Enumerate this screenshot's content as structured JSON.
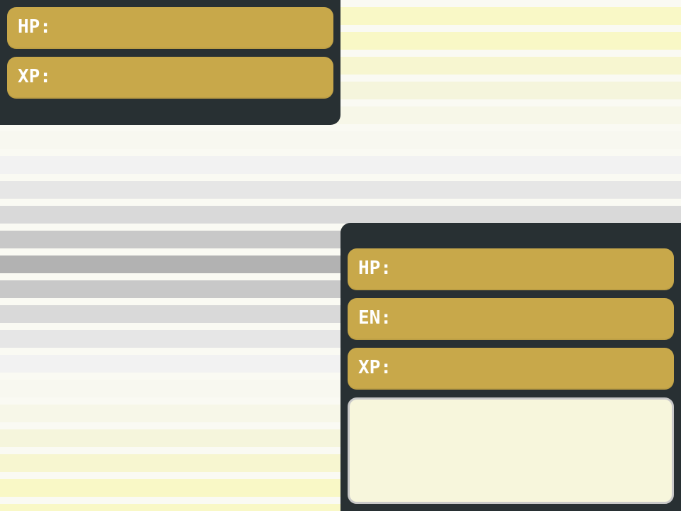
{
  "background": {
    "stripe_colors": [
      "#f9f8c6",
      "#f9f8c6",
      "#f7f6d0",
      "#f5f5dc",
      "#f7f7e8",
      "#f8f8f0",
      "#f2f2f2",
      "#e6e6e6",
      "#d9d9d9",
      "#c8c8c8",
      "#b2b2b2",
      "#c8c8c8",
      "#d9d9d9",
      "#e6e6e6",
      "#f2f2f2",
      "#f8f8f0",
      "#f7f7e8",
      "#f5f5dc",
      "#f7f6d0",
      "#f9f8c6",
      "#f9f8c6"
    ]
  },
  "enemy": {
    "hp_label": "HP:",
    "xp_label": "XP:"
  },
  "player": {
    "hp_label": "HP:",
    "en_label": "EN:",
    "xp_label": "XP:"
  },
  "message": {
    "text": ""
  },
  "colors": {
    "panel": "#283033",
    "stat_bar": "#c8a84a",
    "message_box": "#f7f6dc",
    "label_text": "#ffffff"
  }
}
